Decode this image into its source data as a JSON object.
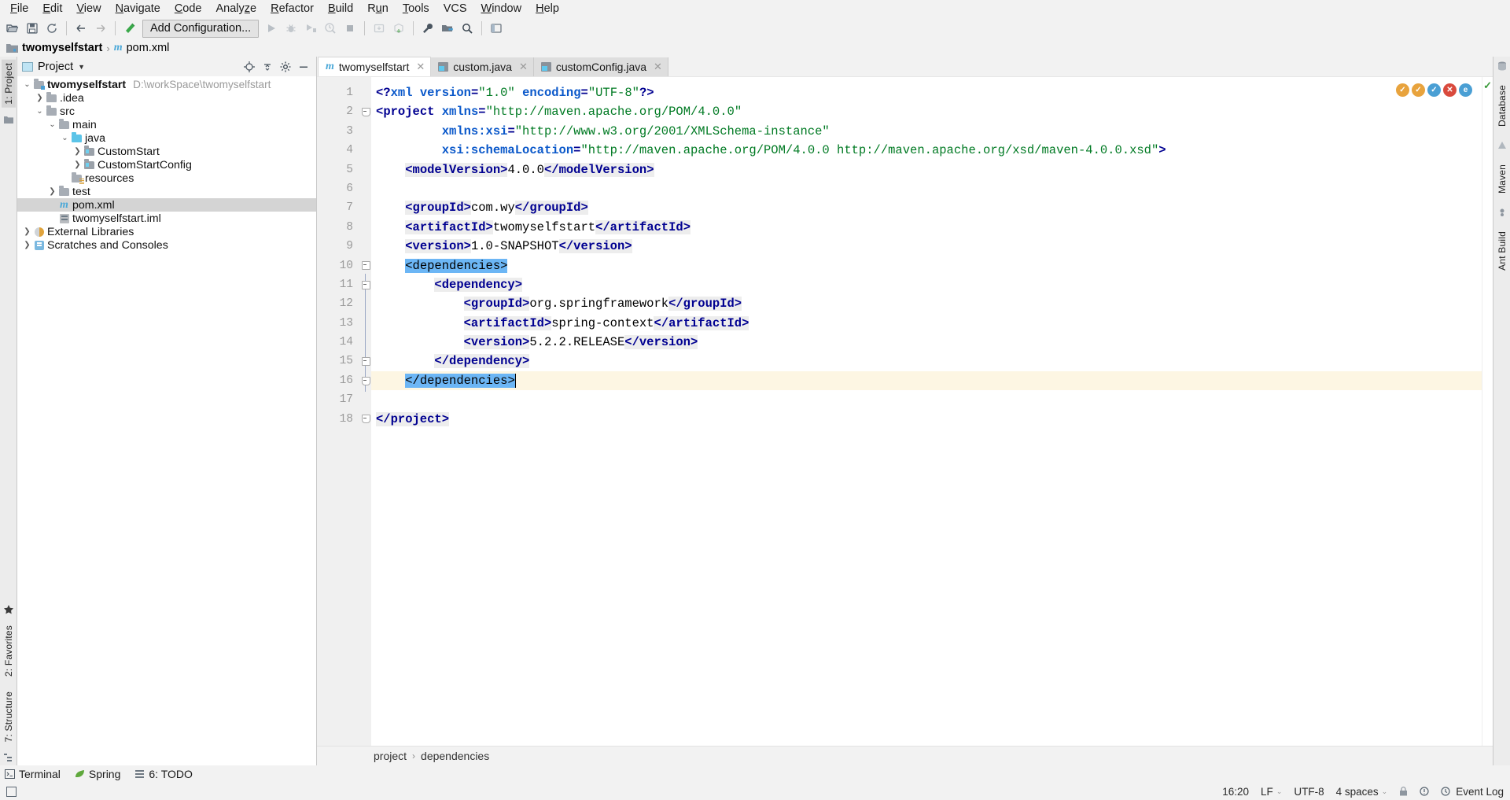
{
  "menubar": {
    "items": [
      "File",
      "Edit",
      "View",
      "Navigate",
      "Code",
      "Analyze",
      "Refactor",
      "Build",
      "Run",
      "Tools",
      "VCS",
      "Window",
      "Help"
    ]
  },
  "toolbar": {
    "open_icon": "open-folder-icon",
    "save_icon": "save-icon",
    "sync_icon": "sync-icon",
    "back_icon": "back-arrow-icon",
    "forward_icon": "forward-arrow-icon",
    "build_icon": "build-hammer-icon",
    "run_config_label": "Add Configuration...",
    "run_icon": "run-icon",
    "debug_icon": "debug-icon",
    "run_coverage_icon": "run-coverage-icon",
    "profile_icon": "profile-icon",
    "stop_icon": "stop-icon",
    "update_project_icon": "update-project-icon",
    "commit_icon": "commit-icon",
    "settings_icon": "wrench-icon",
    "project_structure_icon": "project-structure-icon",
    "search_icon": "search-icon",
    "layout_icon": "layout-icon"
  },
  "navbar": {
    "project_name": "twomyselfstart",
    "file_name": "pom.xml",
    "separator": "›"
  },
  "left_rail": {
    "project_label": "1: Project",
    "favorites_label": "2: Favorites",
    "structure_label": "7: Structure"
  },
  "right_rail": {
    "database_label": "Database",
    "maven_label": "Maven",
    "ant_build_label": "Ant Build"
  },
  "project_panel": {
    "title": "Project",
    "dropdown_icon": "chevron-down-icon",
    "locate_icon": "target-icon",
    "collapse_icon": "collapse-all-icon",
    "settings_icon": "gear-icon",
    "hide_icon": "hide-icon",
    "tree": [
      {
        "label": "twomyselfstart",
        "path": "D:\\workSpace\\twomyselfstart",
        "indent": 0,
        "arrow": "expanded",
        "icon": "module-folder-icon",
        "bold": true,
        "selected": false
      },
      {
        "label": ".idea",
        "path": "",
        "indent": 1,
        "arrow": "collapsed",
        "icon": "folder-icon",
        "bold": false,
        "selected": false
      },
      {
        "label": "src",
        "path": "",
        "indent": 1,
        "arrow": "expanded",
        "icon": "folder-icon",
        "bold": false,
        "selected": false
      },
      {
        "label": "main",
        "path": "",
        "indent": 2,
        "arrow": "expanded",
        "icon": "folder-icon",
        "bold": false,
        "selected": false
      },
      {
        "label": "java",
        "path": "",
        "indent": 3,
        "arrow": "expanded",
        "icon": "source-folder-icon",
        "bold": false,
        "selected": false
      },
      {
        "label": "CustomStart",
        "path": "",
        "indent": 4,
        "arrow": "collapsed",
        "icon": "package-icon",
        "bold": false,
        "selected": false
      },
      {
        "label": "CustomStartConfig",
        "path": "",
        "indent": 4,
        "arrow": "collapsed",
        "icon": "package-icon",
        "bold": false,
        "selected": false
      },
      {
        "label": "resources",
        "path": "",
        "indent": 3,
        "arrow": "none",
        "icon": "resources-folder-icon",
        "bold": false,
        "selected": false
      },
      {
        "label": "test",
        "path": "",
        "indent": 2,
        "arrow": "collapsed",
        "icon": "folder-icon",
        "bold": false,
        "selected": false
      },
      {
        "label": "pom.xml",
        "path": "",
        "indent": 2,
        "arrow": "none",
        "icon": "maven-icon",
        "bold": false,
        "selected": true
      },
      {
        "label": "twomyselfstart.iml",
        "path": "",
        "indent": 2,
        "arrow": "none",
        "icon": "iml-icon",
        "bold": false,
        "selected": false
      },
      {
        "label": "External Libraries",
        "path": "",
        "indent": 0,
        "arrow": "collapsed",
        "icon": "library-icon",
        "bold": false,
        "selected": false
      },
      {
        "label": "Scratches and Consoles",
        "path": "",
        "indent": 0,
        "arrow": "collapsed",
        "icon": "scratches-icon",
        "bold": false,
        "selected": false
      }
    ]
  },
  "editor": {
    "tabs": [
      {
        "label": "twomyselfstart",
        "icon": "maven-icon",
        "active": true,
        "close_icon": "close-icon"
      },
      {
        "label": "custom.java",
        "icon": "java-file-icon",
        "active": false,
        "close_icon": "close-icon"
      },
      {
        "label": "customConfig.java",
        "icon": "java-file-icon",
        "active": false,
        "close_icon": "close-icon"
      }
    ],
    "current_line": 16,
    "inspection_ok_icon": "checkmark-icon",
    "line_numbers": [
      1,
      2,
      3,
      4,
      5,
      6,
      7,
      8,
      9,
      10,
      11,
      12,
      13,
      14,
      15,
      16,
      17,
      18
    ],
    "code_lines": [
      {
        "n": 1,
        "indent": 0,
        "tokens": [
          {
            "t": "<?",
            "c": "punc"
          },
          {
            "t": "xml",
            "c": "at"
          },
          {
            "t": " ",
            "c": "txt"
          },
          {
            "t": "version",
            "c": "at"
          },
          {
            "t": "=",
            "c": "punc"
          },
          {
            "t": "\"1.0\"",
            "c": "vl"
          },
          {
            "t": " ",
            "c": "txt"
          },
          {
            "t": "encoding",
            "c": "at"
          },
          {
            "t": "=",
            "c": "punc"
          },
          {
            "t": "\"UTF-8\"",
            "c": "vl"
          },
          {
            "t": "?>",
            "c": "punc"
          }
        ]
      },
      {
        "n": 2,
        "indent": 0,
        "tokens": [
          {
            "t": "<",
            "c": "punc"
          },
          {
            "t": "project",
            "c": "tg2"
          },
          {
            "t": " ",
            "c": "txt"
          },
          {
            "t": "xmlns",
            "c": "at"
          },
          {
            "t": "=",
            "c": "punc"
          },
          {
            "t": "\"http://maven.apache.org/POM/4.0.0\"",
            "c": "vl"
          }
        ]
      },
      {
        "n": 3,
        "indent": 0,
        "tokens": [
          {
            "t": "         ",
            "c": "txt"
          },
          {
            "t": "xmlns:xsi",
            "c": "at"
          },
          {
            "t": "=",
            "c": "punc"
          },
          {
            "t": "\"http://www.w3.org/2001/XMLSchema-instance\"",
            "c": "vl"
          }
        ]
      },
      {
        "n": 4,
        "indent": 0,
        "tokens": [
          {
            "t": "         ",
            "c": "txt"
          },
          {
            "t": "xsi:schemaLocation",
            "c": "at"
          },
          {
            "t": "=",
            "c": "punc"
          },
          {
            "t": "\"http://maven.apache.org/POM/4.0.0 http://maven.apache.org/xsd/maven-4.0.0.xsd\"",
            "c": "vl"
          },
          {
            "t": ">",
            "c": "punc"
          }
        ]
      },
      {
        "n": 5,
        "indent": 0,
        "tokens": [
          {
            "t": "    ",
            "c": "txt"
          },
          {
            "t": "<modelVersion>",
            "c": "tg"
          },
          {
            "t": "4.0.0",
            "c": "txt"
          },
          {
            "t": "</modelVersion>",
            "c": "tg"
          }
        ]
      },
      {
        "n": 6,
        "indent": 0,
        "tokens": []
      },
      {
        "n": 7,
        "indent": 0,
        "tokens": [
          {
            "t": "    ",
            "c": "txt"
          },
          {
            "t": "<groupId>",
            "c": "tg"
          },
          {
            "t": "com.wy",
            "c": "txt"
          },
          {
            "t": "</groupId>",
            "c": "tg"
          }
        ]
      },
      {
        "n": 8,
        "indent": 0,
        "tokens": [
          {
            "t": "    ",
            "c": "txt"
          },
          {
            "t": "<artifactId>",
            "c": "tg"
          },
          {
            "t": "twomyselfstart",
            "c": "txt"
          },
          {
            "t": "</artifactId>",
            "c": "tg"
          }
        ]
      },
      {
        "n": 9,
        "indent": 0,
        "tokens": [
          {
            "t": "    ",
            "c": "txt"
          },
          {
            "t": "<version>",
            "c": "tg"
          },
          {
            "t": "1.0-SNAPSHOT",
            "c": "txt"
          },
          {
            "t": "</version>",
            "c": "tg"
          }
        ]
      },
      {
        "n": 10,
        "indent": 0,
        "tokens": [
          {
            "t": "    ",
            "c": "txt"
          },
          {
            "t": "<dependencies>",
            "c": "selhl"
          }
        ]
      },
      {
        "n": 11,
        "indent": 0,
        "tokens": [
          {
            "t": "        ",
            "c": "txt"
          },
          {
            "t": "<dependency>",
            "c": "tg"
          }
        ]
      },
      {
        "n": 12,
        "indent": 0,
        "tokens": [
          {
            "t": "            ",
            "c": "txt"
          },
          {
            "t": "<groupId>",
            "c": "tg"
          },
          {
            "t": "org.springframework",
            "c": "txt"
          },
          {
            "t": "</groupId>",
            "c": "tg"
          }
        ]
      },
      {
        "n": 13,
        "indent": 0,
        "tokens": [
          {
            "t": "            ",
            "c": "txt"
          },
          {
            "t": "<artifactId>",
            "c": "tg"
          },
          {
            "t": "spring-context",
            "c": "txt"
          },
          {
            "t": "</artifactId>",
            "c": "tg"
          }
        ]
      },
      {
        "n": 14,
        "indent": 0,
        "tokens": [
          {
            "t": "            ",
            "c": "txt"
          },
          {
            "t": "<version>",
            "c": "tg"
          },
          {
            "t": "5.2.2.RELEASE",
            "c": "txt"
          },
          {
            "t": "</version>",
            "c": "tg"
          }
        ]
      },
      {
        "n": 15,
        "indent": 0,
        "tokens": [
          {
            "t": "        ",
            "c": "txt"
          },
          {
            "t": "</dependency>",
            "c": "tg"
          }
        ]
      },
      {
        "n": 16,
        "indent": 0,
        "tokens": [
          {
            "t": "    ",
            "c": "txt"
          },
          {
            "t": "</dependencies>",
            "c": "selhl"
          }
        ]
      },
      {
        "n": 17,
        "indent": 0,
        "tokens": []
      },
      {
        "n": 18,
        "indent": 0,
        "tokens": [
          {
            "t": "",
            "c": "txt"
          },
          {
            "t": "</project>",
            "c": "tg"
          }
        ]
      }
    ],
    "breadcrumb": {
      "items": [
        "project",
        "dependencies"
      ],
      "separator": "›"
    }
  },
  "bottom": {
    "terminal_label": "Terminal",
    "terminal_icon": "terminal-icon",
    "spring_label": "Spring",
    "spring_icon": "spring-leaf-icon",
    "todo_label": "6: TODO",
    "todo_icon": "todo-icon",
    "event_log_label": "Event Log",
    "event_log_icon": "event-log-icon"
  },
  "statusbar": {
    "left_icon": "terminal-toggle-icon",
    "time": "16:20",
    "line_separator": "LF",
    "encoding": "UTF-8",
    "indent": "4 spaces",
    "lock_icon": "lock-icon",
    "inspection_icon": "inspection-icon",
    "chevron_icon": "chevron-icon"
  },
  "colors": {
    "accent_blue": "#6cb6f5",
    "tag_blue": "#000091",
    "attr_blue": "#0a58ca",
    "value_green": "#007a23",
    "panel_bg": "#f2f2f2",
    "selection_gray": "#d4d4d4",
    "current_line": "#fdf6e3"
  }
}
